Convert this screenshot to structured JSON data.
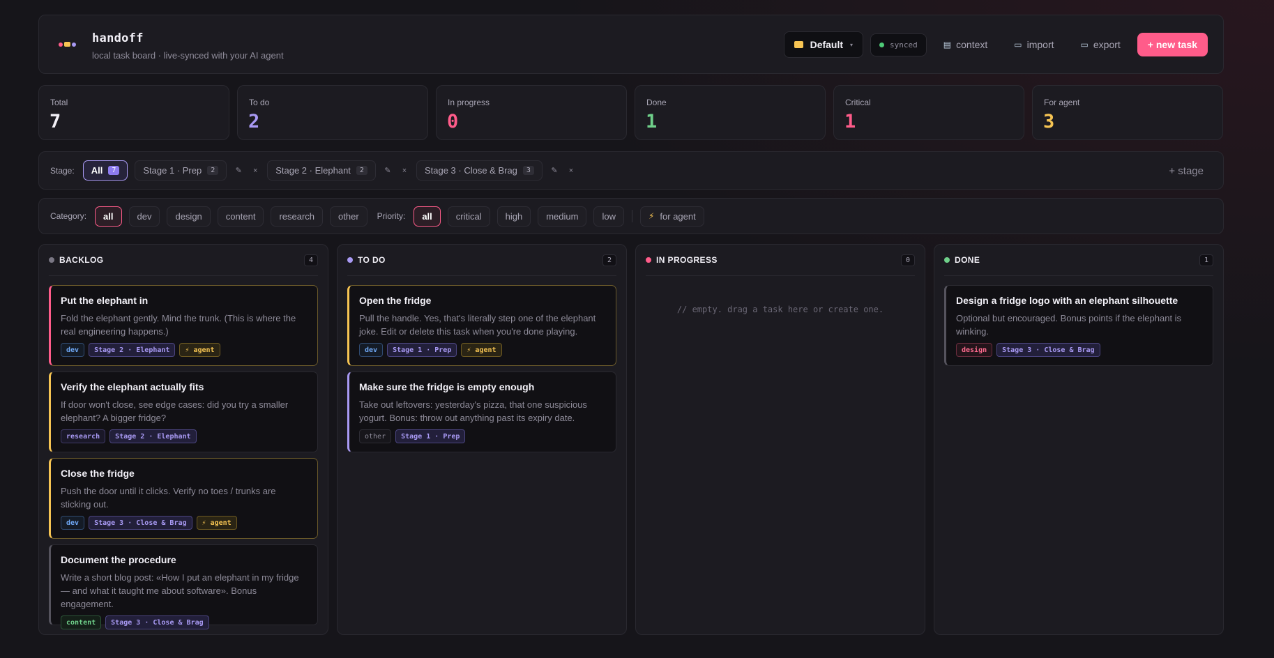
{
  "header": {
    "title": "handoff",
    "subtitle": "local task board · live-synced with your AI agent",
    "board_name": "Default",
    "board_caret": "▾",
    "sync_status": "synced",
    "context_label": "context",
    "import_label": "import",
    "export_label": "export",
    "new_task_label": "+ new task"
  },
  "stats": [
    {
      "label": "Total",
      "value": "7",
      "color": "#f2f0f7"
    },
    {
      "label": "To do",
      "value": "2",
      "color": "#a99af4"
    },
    {
      "label": "In progress",
      "value": "0",
      "color": "#ff5c8a"
    },
    {
      "label": "Done",
      "value": "1",
      "color": "#6fd08a"
    },
    {
      "label": "Critical",
      "value": "1",
      "color": "#ff5c8a"
    },
    {
      "label": "For agent",
      "value": "3",
      "color": "#f6c453"
    }
  ],
  "stages": {
    "label": "Stage:",
    "all": {
      "label": "All",
      "count": "7"
    },
    "items": [
      {
        "label": "Stage 1 · Prep",
        "count": "2"
      },
      {
        "label": "Stage 2 · Elephant",
        "count": "2"
      },
      {
        "label": "Stage 3 · Close & Brag",
        "count": "3"
      }
    ],
    "edit_glyph": "✎",
    "delete_glyph": "×",
    "add_label": "+ stage"
  },
  "filters": {
    "category_label": "Category:",
    "categories": [
      "all",
      "dev",
      "design",
      "content",
      "research",
      "other"
    ],
    "priority_label": "Priority:",
    "priorities": [
      "all",
      "critical",
      "high",
      "medium",
      "low"
    ],
    "agent_label": "for agent"
  },
  "columns": [
    {
      "title": "BACKLOG",
      "count": "4",
      "color": "#7a7784"
    },
    {
      "title": "TO DO",
      "count": "2",
      "color": "#a99af4"
    },
    {
      "title": "IN PROGRESS",
      "count": "0",
      "color": "#ff5c8a",
      "empty": "// empty. drag a task here or create one."
    },
    {
      "title": "DONE",
      "count": "1",
      "color": "#6fd08a"
    }
  ],
  "cards": {
    "backlog": [
      {
        "title": "Put the elephant in",
        "desc": "Fold the elephant gently. Mind the trunk. (This is where the real engineering happens.)",
        "category": "dev",
        "stage": "Stage 2 · Elephant",
        "agent": "⚡ agent"
      },
      {
        "title": "Verify the elephant actually fits",
        "desc": "If door won't close, see edge cases: did you try a smaller elephant? A bigger fridge?",
        "category": "research",
        "stage": "Stage 2 · Elephant"
      },
      {
        "title": "Close the fridge",
        "desc": "Push the door until it clicks. Verify no toes / trunks are sticking out.",
        "category": "dev",
        "stage": "Stage 3 · Close & Brag",
        "agent": "⚡ agent"
      },
      {
        "title": "Document the procedure",
        "desc": "Write a short blog post: «How I put an elephant in my fridge — and what it taught me about software». Bonus engagement.",
        "category": "content",
        "stage": "Stage 3 · Close & Brag"
      }
    ],
    "todo": [
      {
        "title": "Open the fridge",
        "desc": "Pull the handle. Yes, that's literally step one of the elephant joke. Edit or delete this task when you're done playing.",
        "category": "dev",
        "stage": "Stage 1 · Prep",
        "agent": "⚡ agent"
      },
      {
        "title": "Make sure the fridge is empty enough",
        "desc": "Take out leftovers: yesterday's pizza, that one suspicious yogurt. Bonus: throw out anything past its expiry date.",
        "category": "other",
        "stage": "Stage 1 · Prep"
      }
    ],
    "done": [
      {
        "title": "Design a fridge logo with an elephant silhouette",
        "desc": "Optional but encouraged. Bonus points if the elephant is winking.",
        "category": "design",
        "stage": "Stage 3 · Close & Brag"
      }
    ]
  },
  "colors": {
    "accent_pink": "#ff5c8a",
    "accent_purple": "#a99af4",
    "agent_yellow": "#f6c453",
    "green": "#6fd08a",
    "background": "#16151a"
  }
}
